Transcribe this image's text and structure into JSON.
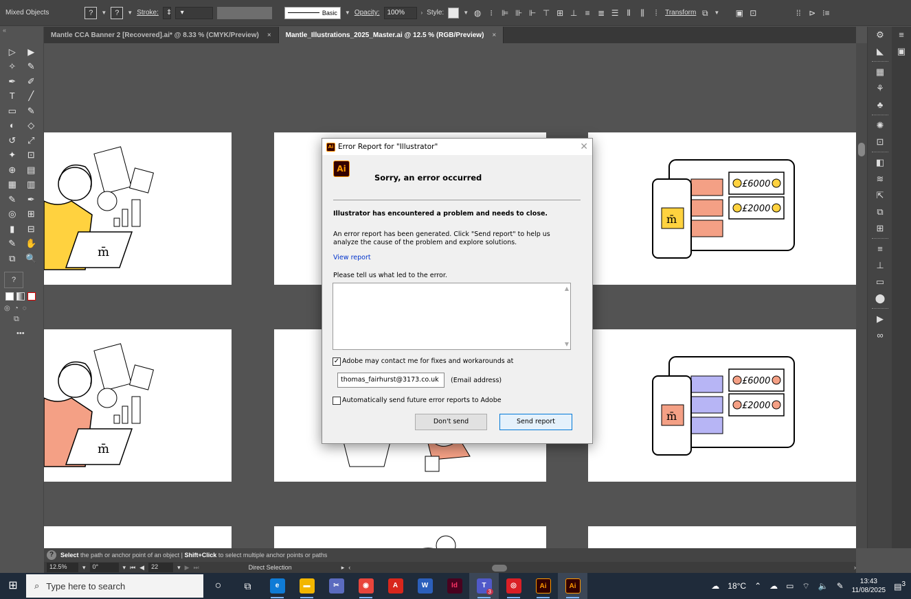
{
  "controlbar": {
    "selection": "Mixed Objects",
    "fill_box": "?",
    "stroke_box": "?",
    "stroke_label": "Stroke:",
    "brush_label": "Basic",
    "opacity_label": "Opacity:",
    "opacity_value": "100%",
    "style_label": "Style:",
    "transform_label": "Transform"
  },
  "tabs": [
    {
      "label": "Mantle CCA Banner 2 [Recovered].ai* @ 8.33 % (CMYK/Preview)",
      "close": "×"
    },
    {
      "label": "Mantle_Illustrations_2025_Master.ai @ 12.5 % (RGB/Preview)",
      "close": "×"
    }
  ],
  "toolbar": {
    "rows": [
      [
        "▷",
        "▶"
      ],
      [
        "✧",
        "✎"
      ],
      [
        "✒",
        "✐"
      ],
      [
        "T",
        "╱"
      ],
      [
        "▭",
        "✎"
      ],
      [
        "◐",
        "◇"
      ],
      [
        "↺",
        "⤢"
      ],
      [
        "✦",
        "⊡"
      ],
      [
        "⊕",
        "▤"
      ],
      [
        "▦",
        "▥"
      ],
      [
        "✎",
        "✒"
      ],
      [
        "◎",
        "⊞"
      ],
      [
        "▮",
        "⊟"
      ],
      [
        "✎",
        "✋"
      ],
      [
        "⧉",
        "🔍"
      ]
    ],
    "unknown": "?",
    "more": "•••"
  },
  "right_icons_1": [
    "⚙",
    "◣",
    "⋯",
    "▦",
    "⚘",
    "♣",
    "⋯",
    "✺",
    "⊡",
    "⋯",
    "◧",
    "≋",
    "⇱",
    "⧉",
    "⊞",
    "⋯",
    "≡",
    "⊥",
    "▭",
    "⬤",
    "⋯",
    "▶",
    "∞"
  ],
  "right_icons_2": [
    "≡",
    "▣"
  ],
  "status": {
    "hint_bold": "Select",
    "hint": "the path or anchor point of an object",
    "sep": "|",
    "hint2_bold": "Shift+Click",
    "hint2": "to select multiple anchor points or paths"
  },
  "nav": {
    "zoom": "12.5%",
    "rotate": "0°",
    "artboard": "22",
    "tool": "Direct Selection"
  },
  "artwork": {
    "amount1": "£6000",
    "amount2": "£2000",
    "logo": "m̄"
  },
  "dialog": {
    "title": "Error Report for \"Illustrator\"",
    "app_badge": "Ai",
    "heading": "Sorry, an error occurred",
    "message": "Illustrator has encountered a problem and needs to close.",
    "body": "An error report has been generated. Click \"Send report\" to help us analyze the cause of the problem and explore solutions.",
    "view_report": "View report",
    "prompt": "Please tell us what led to the error.",
    "contact_label": "Adobe may contact me for fixes and workarounds at",
    "contact_checked": true,
    "email": "thomas_fairhurst@3173.co.uk",
    "email_label": "(Email address)",
    "auto_label": "Automatically send future error reports to Adobe",
    "auto_checked": false,
    "dont_send": "Don't send",
    "send_report": "Send report"
  },
  "taskbar": {
    "search_placeholder": "Type here to search",
    "weather": "18°C",
    "time": "13:43",
    "date": "11/08/2025",
    "notification_count": "3",
    "teams_badge": "3",
    "apps": [
      {
        "name": "edge",
        "label": "e",
        "color": "#0f7bd6"
      },
      {
        "name": "file-explorer",
        "label": "▬",
        "color": "#f2b600"
      },
      {
        "name": "snipping",
        "label": "✂",
        "color": "#5b6bbf"
      },
      {
        "name": "chrome",
        "label": "◉",
        "color": "#e8453c"
      },
      {
        "name": "acrobat",
        "label": "A",
        "color": "#d8261c"
      },
      {
        "name": "word",
        "label": "W",
        "color": "#2b5fbb"
      },
      {
        "name": "indesign",
        "label": "Id",
        "color": "#49021f"
      },
      {
        "name": "teams",
        "label": "T",
        "color": "#5059c9"
      },
      {
        "name": "creative-cloud",
        "label": "◎",
        "color": "#da1f26"
      },
      {
        "name": "illustrator-1",
        "label": "Ai",
        "color": "#330000"
      },
      {
        "name": "illustrator-2",
        "label": "Ai",
        "color": "#330000"
      }
    ]
  }
}
